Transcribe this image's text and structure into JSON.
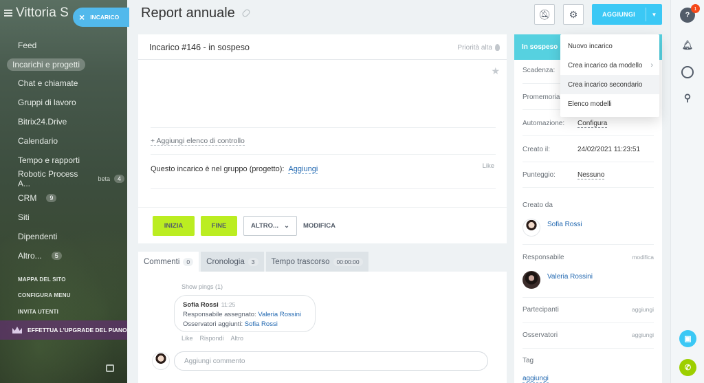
{
  "sidebar": {
    "brand": "Vittoria S",
    "items": [
      {
        "label": "Feed",
        "active": false
      },
      {
        "label": "Incarichi e progetti",
        "active": true
      },
      {
        "label": "Chat e chiamate",
        "active": false
      },
      {
        "label": "Gruppi di lavoro",
        "active": false
      },
      {
        "label": "Bitrix24.Drive",
        "active": false
      },
      {
        "label": "Calendario",
        "active": false
      },
      {
        "label": "Tempo e rapporti",
        "active": false
      },
      {
        "label": "Robotic Process A...",
        "active": false,
        "beta": "beta",
        "counter": "4"
      },
      {
        "label": "CRM",
        "active": false,
        "counter": "9"
      },
      {
        "label": "Siti",
        "active": false
      },
      {
        "label": "Dipendenti",
        "active": false
      },
      {
        "label": "Altro...",
        "active": false,
        "counter": "5"
      }
    ],
    "site_map": "MAPPA DEL SITO",
    "configure_menu": "CONFIGURA MENU",
    "invite_users": "INVITA UTENTI",
    "upgrade": "EFFETTUA L'UPGRADE DEL PIANO"
  },
  "task_tab": {
    "label": "INCARICO"
  },
  "header": {
    "title": "Report annuale",
    "add_label": "AGGIUNGI"
  },
  "task": {
    "heading": "Incarico #146 - in sospeso",
    "priority": "Priorità alta",
    "checklist_link": "+ Aggiungi elenco di controllo",
    "group_text": "Questo incarico è nel gruppo (progetto):",
    "group_link": "Aggiungi",
    "like": "Like",
    "buttons": {
      "start": "INIZIA",
      "finish": "FINE",
      "more": "ALTRO...",
      "modify": "MODIFICA"
    }
  },
  "tabs": [
    {
      "label": "Commenti",
      "count": "0"
    },
    {
      "label": "Cronologia",
      "count": "3"
    },
    {
      "label": "Tempo trascorso",
      "count": "00:00:00"
    }
  ],
  "comments": {
    "show_pings": "Show pings (1)",
    "author": "Sofia Rossi",
    "time": "11:25",
    "line1_prefix": "Responsabile assegnato:",
    "line1_name": "Valeria Rossini",
    "line2_prefix": "Osservatori aggiunti:",
    "line2_name": "Sofia Rossi",
    "actions": [
      "Like",
      "Rispondi",
      "Altro"
    ],
    "input_placeholder": "Aggiungi commento"
  },
  "right_panel": {
    "status": "In sospeso",
    "deadline_label": "Scadenza:",
    "reminder_label": "Promemoria",
    "automation_label": "Automazione:",
    "automation_value": "Configura",
    "created_label": "Creato il:",
    "created_value": "24/02/2021 11:23:51",
    "score_label": "Punteggio:",
    "score_value": "Nessuno",
    "created_by_label": "Creato da",
    "created_by": "Sofia Rossi",
    "responsible_label": "Responsabile",
    "responsible_action": "modifica",
    "responsible": "Valeria Rossini",
    "participants_label": "Partecipanti",
    "participants_action": "aggiungi",
    "observers_label": "Osservatori",
    "observers_action": "aggiungi",
    "tags_label": "Tag",
    "tags_action": "aggiungi"
  },
  "dropdown": {
    "items": [
      {
        "label": "Nuovo incarico"
      },
      {
        "label": "Crea incarico da modello",
        "submenu": "›"
      },
      {
        "label": "Crea incarico secondario"
      },
      {
        "label": "Elenco modelli"
      }
    ]
  },
  "toolbar": {
    "help_badge": "1",
    "help_label": "?"
  },
  "colors": {
    "accent": "#3bc8f5",
    "green": "#bbed21",
    "status": "#56d1e0",
    "call": "#9dcf00"
  }
}
